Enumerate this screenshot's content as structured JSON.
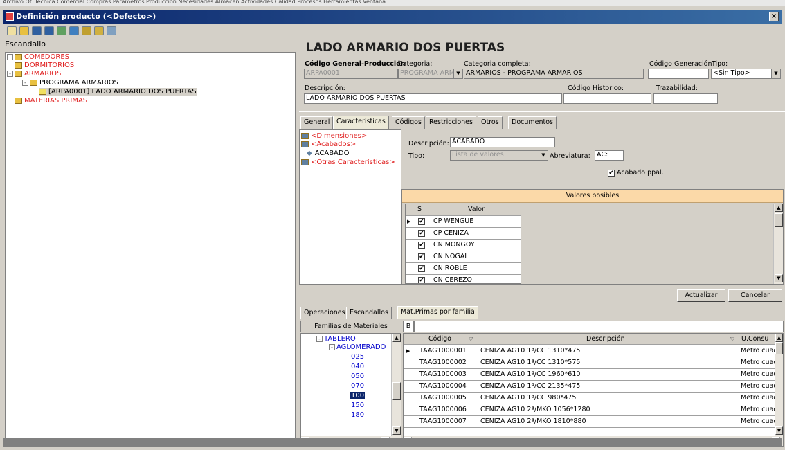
{
  "menubar": {
    "text": "Archivo  Of. Técnica  Comercial  Compras  Parámetros  Producción  Necesidades  Almacén  Actividades  Calidad  Procesos  Herramientas  Ventana"
  },
  "window": {
    "title": "Definición producto (<Defecto>)",
    "close": "×"
  },
  "left": {
    "header": "Escandallo",
    "tree": [
      {
        "label": "COMEDORES",
        "color": "red"
      },
      {
        "label": "DORMITORIOS",
        "color": "red"
      },
      {
        "label": "ARMARIOS",
        "color": "red"
      },
      {
        "label": "PROGRAMA ARMARIOS",
        "color": "black"
      },
      {
        "label": "[ARPA0001] LADO ARMARIO DOS PUERTAS",
        "color": "black"
      },
      {
        "label": "MATERIAS PRIMAS",
        "color": "red"
      }
    ]
  },
  "product": {
    "title": "LADO ARMARIO DOS PUERTAS",
    "codigo_label": "Código General-Producción",
    "codigo_value": "ARPA0001",
    "categoria_label": "Categoria:",
    "categoria_value": "PROGRAMA ARM",
    "cat_completa_label": "Categoria completa:",
    "cat_completa_value": "ARMARIOS - PROGRAMA ARMARIOS",
    "cod_gen_label": "Código Generación",
    "cod_gen_value": "",
    "tipo_label": "Tipo:",
    "tipo_value": "<Sin Tipo>",
    "desc_label": "Descripción:",
    "desc_value": "LADO ARMARIO DOS PUERTAS",
    "historico_label": "Código Historico:",
    "historico_value": "",
    "traz_label": "Trazabilidad:",
    "traz_value": ""
  },
  "tabs_top": [
    "General",
    "Características",
    "Códigos",
    "Restricciones",
    "Otros",
    "Documentos"
  ],
  "caract_tree": [
    "<Dimensiones>",
    "<Acabados>",
    "ACABADO",
    "<Otras Características>"
  ],
  "caract": {
    "desc_label": "Descripción:",
    "desc_value": "ACABADO",
    "tipo_label": "Tipo:",
    "tipo_value": "Lista de valores",
    "abrev_label": "Abreviatura:",
    "abrev_value": "AC:",
    "acabado_label": "Acabado ppal."
  },
  "valores": {
    "header": "Valores posibles",
    "col_s": "S",
    "col_valor": "Valor",
    "rows": [
      "CP WENGUE",
      "CP CENIZA",
      "CN MONGOY",
      "CN NOGAL",
      "CN ROBLE",
      "CN CEREZO"
    ]
  },
  "buttons": {
    "actualizar": "Actualizar",
    "cancelar": "Cancelar"
  },
  "tabs_bottom": [
    "Operaciones",
    "Escandallos",
    "Mat.Primas por familia"
  ],
  "familias": {
    "header": "Familias de Materiales",
    "b_label": "B",
    "items": [
      "TABLERO",
      "AGLOMERADO",
      "025",
      "040",
      "050",
      "070",
      "100",
      "150",
      "180"
    ]
  },
  "materiales": {
    "col_codigo": "Código",
    "col_desc": "Descripción",
    "col_ucons": "U.Consu",
    "rows": [
      {
        "codigo": "TAAG1000001",
        "desc": "CENIZA AG10 1ª/CC 1310*475",
        "u": "Metro cuad"
      },
      {
        "codigo": "TAAG1000002",
        "desc": "CENIZA AG10 1ª/CC 1310*575",
        "u": "Metro cuad"
      },
      {
        "codigo": "TAAG1000003",
        "desc": "CENIZA AG10 1ª/CC 1960*610",
        "u": "Metro cuad"
      },
      {
        "codigo": "TAAG1000004",
        "desc": "CENIZA AG10 1ª/CC 2135*475",
        "u": "Metro cuad"
      },
      {
        "codigo": "TAAG1000005",
        "desc": "CENIZA AG10 1ª/CC 980*475",
        "u": "Metro cuad"
      },
      {
        "codigo": "TAAG1000006",
        "desc": "CENIZA AG10 2ª/MKO 1056*1280",
        "u": "Metro cuad"
      },
      {
        "codigo": "TAAG1000007",
        "desc": "CENIZA AG10 2ª/MKO 1810*880",
        "u": "Metro cuad"
      }
    ]
  },
  "colors": {
    "titlebar": "#0a246a",
    "red": "#e02020",
    "valores_header": "#fbd9a8",
    "link": "#0000cc"
  }
}
